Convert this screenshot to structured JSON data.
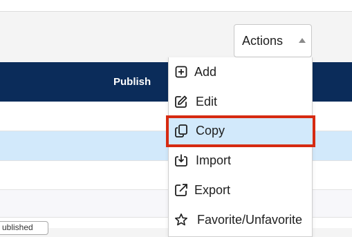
{
  "toolbar": {
    "actions_label": "Actions"
  },
  "table": {
    "columns": [
      "Publish"
    ],
    "partial_chip_text": "ublished"
  },
  "actions_menu": {
    "items": [
      {
        "label": "Add",
        "icon": "plus-square-icon"
      },
      {
        "label": "Edit",
        "icon": "edit-icon"
      },
      {
        "label": "Copy",
        "icon": "copy-icon",
        "highlighted": true
      },
      {
        "label": "Import",
        "icon": "import-icon"
      },
      {
        "label": "Export",
        "icon": "export-icon"
      },
      {
        "label": "Favorite/Unfavorite",
        "icon": "star-icon"
      }
    ]
  },
  "colors": {
    "header_bg": "#0b2c5a",
    "selected_row": "#d2e9fb",
    "highlight_border": "#d62a11"
  }
}
